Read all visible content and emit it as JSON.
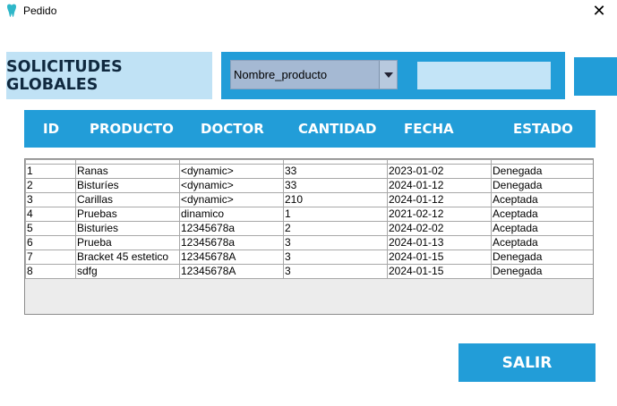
{
  "window": {
    "title": "Pedido",
    "close_glyph": "✕",
    "icon": "tooth-icon"
  },
  "header": {
    "title": "SOLICITUDES GLOBALES"
  },
  "filter": {
    "selected": "Nombre_producto",
    "search_value": ""
  },
  "columns": [
    "ID",
    "PRODUCTO",
    "DOCTOR",
    "CANTIDAD",
    "FECHA",
    "ESTADO"
  ],
  "rows": [
    [
      "1",
      "Ranas",
      "<dynamic>",
      "33",
      "2023-01-02",
      "Denegada"
    ],
    [
      "2",
      "Bisturíes",
      "<dynamic>",
      "33",
      "2024-01-12",
      "Denegada"
    ],
    [
      "3",
      "Carillas",
      "<dynamic>",
      "210",
      "2024-01-12",
      "Aceptada"
    ],
    [
      "4",
      "Pruebas",
      "dinamico",
      "1",
      "2021-02-12",
      "Aceptada"
    ],
    [
      "5",
      "Bisturies",
      "12345678a",
      "2",
      "2024-02-02",
      "Aceptada"
    ],
    [
      "6",
      "Prueba",
      "12345678a",
      "3",
      "2024-01-13",
      "Aceptada"
    ],
    [
      "7",
      "Bracket 45 estetico",
      "12345678A",
      "3",
      "2024-01-15",
      "Denegada"
    ],
    [
      "8",
      "sdfg",
      "12345678A",
      "3",
      "2024-01-15",
      "Denegada"
    ]
  ],
  "actions": {
    "exit_label": "SALIR"
  },
  "colors": {
    "accent": "#229dd8",
    "label_bg": "#c0e2f5",
    "combo_bg": "#a5b9d3"
  }
}
